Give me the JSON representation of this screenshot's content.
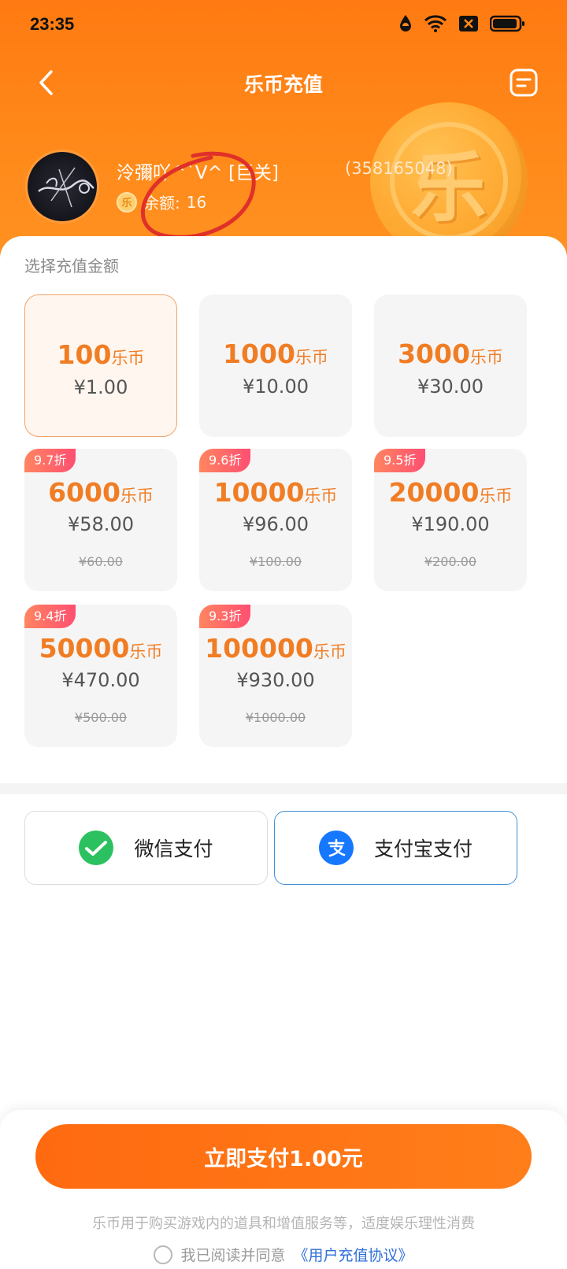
{
  "status_bar": {
    "time": "23:35"
  },
  "nav": {
    "title": "乐币充值"
  },
  "user": {
    "name": "泠彌吖^`V^ [巨关]",
    "id": "(358165048)",
    "balance_label": "余额:",
    "balance_value": "16",
    "coin_char": "乐"
  },
  "section_title": "选择充值金额",
  "currency_unit": "乐币",
  "options": [
    {
      "amount": "100",
      "price": "¥1.00",
      "original": "",
      "badge": "",
      "selected": true
    },
    {
      "amount": "1000",
      "price": "¥10.00",
      "original": "",
      "badge": "",
      "selected": false
    },
    {
      "amount": "3000",
      "price": "¥30.00",
      "original": "",
      "badge": "",
      "selected": false
    },
    {
      "amount": "6000",
      "price": "¥58.00",
      "original": "¥60.00",
      "badge": "9.7折",
      "selected": false
    },
    {
      "amount": "10000",
      "price": "¥96.00",
      "original": "¥100.00",
      "badge": "9.6折",
      "selected": false
    },
    {
      "amount": "20000",
      "price": "¥190.00",
      "original": "¥200.00",
      "badge": "9.5折",
      "selected": false
    },
    {
      "amount": "50000",
      "price": "¥470.00",
      "original": "¥500.00",
      "badge": "9.4折",
      "selected": false
    },
    {
      "amount": "100000",
      "price": "¥930.00",
      "original": "¥1000.00",
      "badge": "9.3折",
      "selected": false
    }
  ],
  "payment": {
    "wechat_label": "微信支付",
    "alipay_label": "支付宝支付",
    "selected": "alipay"
  },
  "footer": {
    "submit_label": "立即支付1.00元",
    "notice": "乐币用于购买游戏内的道具和增值服务等，适度娱乐理性消费",
    "agree_text": "我已阅读并同意",
    "agreement_link": "《用户充值协议》"
  },
  "colors": {
    "brand_orange": "#ff7a12",
    "amount_orange": "#f07d24",
    "badge_pink": "#ff4f72",
    "wechat_green": "#2cc160",
    "alipay_blue": "#1677ff",
    "link_blue": "#2f6fd8"
  }
}
